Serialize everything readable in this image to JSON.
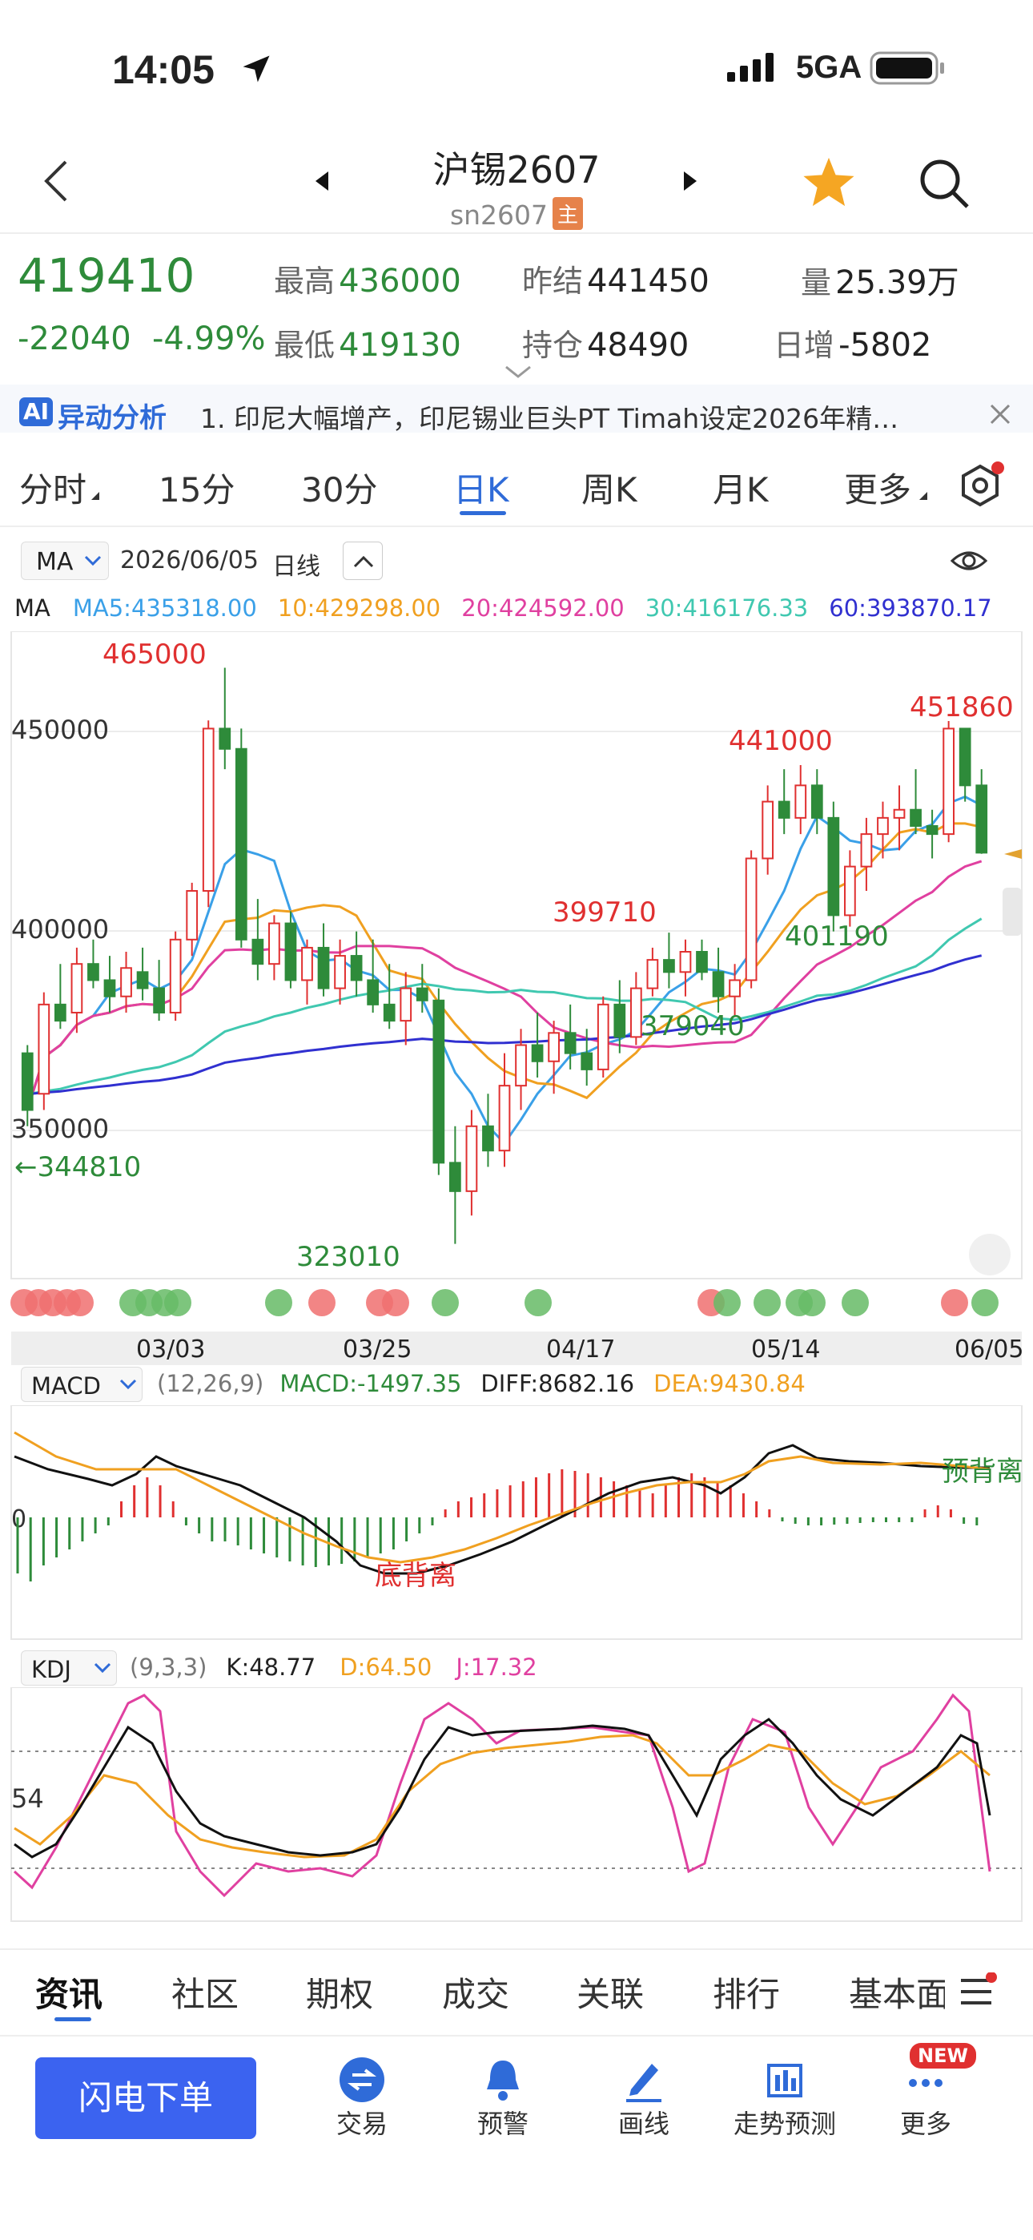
{
  "status_bar": {
    "time": "14:05",
    "network": "5GA"
  },
  "header": {
    "title": "沪锡2607",
    "symbol": "sn2607",
    "symbol_tag": "主"
  },
  "quote": {
    "price": "419410",
    "change": "-22040",
    "change_pct": "-4.99%",
    "high_label": "最高",
    "high": "436000",
    "low_label": "最低",
    "low": "419130",
    "prev_settle_label": "昨结",
    "prev_settle": "441450",
    "position_label": "持仓",
    "position": "48490",
    "volume_label": "量",
    "volume": "25.39万",
    "daily_inc_label": "日增",
    "daily_inc": "-5802"
  },
  "news": {
    "badge": "AI",
    "title": "异动分析",
    "text": "1. 印尼大幅增产，印尼锡业巨头PT Timah设定2026年精…"
  },
  "period_tabs": [
    {
      "label": "分时"
    },
    {
      "label": "15分"
    },
    {
      "label": "30分"
    },
    {
      "label": "日K"
    },
    {
      "label": "周K"
    },
    {
      "label": "月K"
    },
    {
      "label": "更多"
    }
  ],
  "active_tab": "日K",
  "chart_header": {
    "indicator": "MA",
    "date": "2026/06/05",
    "period": "日线"
  },
  "ma_legend": {
    "label": "MA",
    "ma5": "MA5:435318.00",
    "ma10": "10:429298.00",
    "ma20": "20:424592.00",
    "ma30": "30:416176.33",
    "ma60": "60:393870.17"
  },
  "colors": {
    "up": "#e03030",
    "down": "#2e8b3a",
    "accent": "#2f6bd8",
    "ma5": "#3aa0e8",
    "ma10": "#f0a020",
    "ma20": "#e040a0",
    "ma30": "#40c8b0",
    "ma60": "#3030d0"
  },
  "chart_annotations": {
    "high_465000": "465000",
    "low_323010": "323010",
    "p399710": "399710",
    "p379040": "379040",
    "p441000": "441000",
    "p401190": "401190",
    "p451860": "451860",
    "left_344810": "←344810"
  },
  "y_ticks": [
    "450000",
    "400000",
    "350000"
  ],
  "x_ticks": [
    "03/03",
    "03/25",
    "04/17",
    "05/14",
    "06/05"
  ],
  "macd": {
    "label": "MACD",
    "params": "(12,26,9)",
    "macd": "MACD:-1497.35",
    "diff": "DIFF:8682.16",
    "dea": "DEA:9430.84",
    "zero": "0",
    "note_bottom": "底背离",
    "note_top": "预背离"
  },
  "kdj": {
    "label": "KDJ",
    "params": "(9,3,3)",
    "k": "K:48.77",
    "d": "D:64.50",
    "j": "J:17.32",
    "level": "54"
  },
  "bottom_tabs": [
    {
      "label": "资讯"
    },
    {
      "label": "社区"
    },
    {
      "label": "期权"
    },
    {
      "label": "成交"
    },
    {
      "label": "关联"
    },
    {
      "label": "排行"
    },
    {
      "label": "基本面"
    }
  ],
  "bottom_nav": {
    "order_button": "闪电下单",
    "items": [
      {
        "label": "交易",
        "icon": "trade-icon"
      },
      {
        "label": "预警",
        "icon": "bell-icon"
      },
      {
        "label": "画线",
        "icon": "draw-icon"
      },
      {
        "label": "走势预测",
        "icon": "forecast-icon"
      },
      {
        "label": "更多",
        "icon": "more-icon",
        "badge": "NEW"
      }
    ]
  },
  "chart_data": {
    "type": "candlestick",
    "x_ticks": [
      "03/03",
      "03/25",
      "04/17",
      "05/14",
      "06/05"
    ],
    "y_ticks": [
      450000,
      400000,
      350000
    ],
    "ylim": [
      318000,
      472000
    ],
    "candles": [
      [
        370000,
        372000,
        352000,
        356000
      ],
      [
        360000,
        385000,
        356000,
        382000
      ],
      [
        382000,
        392000,
        376000,
        378000
      ],
      [
        380000,
        396000,
        375000,
        392000
      ],
      [
        392000,
        398000,
        386000,
        388000
      ],
      [
        388000,
        394000,
        380000,
        384000
      ],
      [
        384000,
        395000,
        380000,
        391000
      ],
      [
        390000,
        396000,
        383000,
        386000
      ],
      [
        386000,
        393000,
        378000,
        380000
      ],
      [
        380000,
        400000,
        378000,
        398000
      ],
      [
        398000,
        412000,
        394000,
        410000
      ],
      [
        410000,
        452000,
        406000,
        450000
      ],
      [
        450000,
        465000,
        440000,
        445000
      ],
      [
        445000,
        450000,
        396000,
        398000
      ],
      [
        398000,
        408000,
        388000,
        392000
      ],
      [
        392000,
        404000,
        388000,
        402000
      ],
      [
        402000,
        405000,
        386000,
        388000
      ],
      [
        388000,
        398000,
        382000,
        396000
      ],
      [
        396000,
        402000,
        384000,
        386000
      ],
      [
        386000,
        398000,
        382000,
        394000
      ],
      [
        394000,
        400000,
        384000,
        388000
      ],
      [
        388000,
        398000,
        380000,
        382000
      ],
      [
        382000,
        392000,
        376000,
        378000
      ],
      [
        378000,
        390000,
        372000,
        386000
      ],
      [
        386000,
        392000,
        380000,
        383000
      ],
      [
        383000,
        386000,
        340000,
        343000
      ],
      [
        343000,
        352000,
        323010,
        336000
      ],
      [
        336000,
        356000,
        330000,
        352000
      ],
      [
        352000,
        360000,
        342000,
        346000
      ],
      [
        346000,
        370000,
        342000,
        362000
      ],
      [
        362000,
        376000,
        356000,
        372000
      ],
      [
        372000,
        380000,
        364000,
        368000
      ],
      [
        368000,
        378000,
        360000,
        375000
      ],
      [
        375000,
        382000,
        366000,
        370000
      ],
      [
        370000,
        376000,
        362000,
        366000
      ],
      [
        366000,
        384000,
        364000,
        382000
      ],
      [
        382000,
        388000,
        370000,
        374000
      ],
      [
        374000,
        390000,
        372000,
        386000
      ],
      [
        386000,
        396000,
        384000,
        393000
      ],
      [
        393000,
        399710,
        386000,
        390000
      ],
      [
        390000,
        398000,
        384000,
        395000
      ],
      [
        395000,
        398000,
        388000,
        390000
      ],
      [
        390000,
        396000,
        380000,
        384000
      ],
      [
        384000,
        392000,
        379040,
        388000
      ],
      [
        388000,
        420000,
        386000,
        418000
      ],
      [
        418000,
        436000,
        414000,
        432000
      ],
      [
        432000,
        440000,
        424000,
        428000
      ],
      [
        428000,
        441000,
        424000,
        436000
      ],
      [
        436000,
        440000,
        424000,
        428000
      ],
      [
        428000,
        432000,
        400000,
        404000
      ],
      [
        404000,
        420000,
        401190,
        416000
      ],
      [
        416000,
        428000,
        410000,
        424000
      ],
      [
        424000,
        432000,
        418000,
        428000
      ],
      [
        428000,
        436000,
        420000,
        430000
      ],
      [
        430000,
        440000,
        424000,
        426000
      ],
      [
        426000,
        430000,
        418000,
        424000
      ],
      [
        424000,
        451860,
        422000,
        450000
      ],
      [
        450000,
        450000,
        432000,
        436000
      ],
      [
        436000,
        440000,
        419130,
        419410
      ]
    ]
  }
}
